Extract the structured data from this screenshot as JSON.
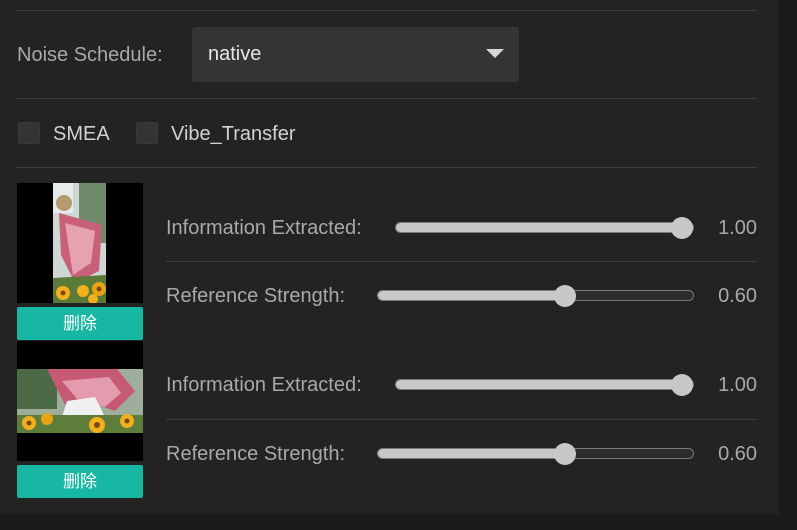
{
  "noise_schedule": {
    "label": "Noise Schedule:",
    "value": "native"
  },
  "options": {
    "smea": {
      "label": "SMEA",
      "checked": false
    },
    "vibe_transfer": {
      "label": "Vibe_Transfer",
      "checked": false
    }
  },
  "references": [
    {
      "image": "sunflower-character-portrait-thumbnail",
      "delete_label": "删除",
      "information_extracted": {
        "label": "Information Extracted:",
        "value": "1.00",
        "fraction": 1.0
      },
      "reference_strength": {
        "label": "Reference Strength:",
        "value": "0.60",
        "fraction": 0.6
      }
    },
    {
      "image": "sunflower-character-landscape-thumbnail",
      "delete_label": "删除",
      "information_extracted": {
        "label": "Information Extracted:",
        "value": "1.00",
        "fraction": 1.0
      },
      "reference_strength": {
        "label": "Reference Strength:",
        "value": "0.60",
        "fraction": 0.6
      }
    }
  ]
}
